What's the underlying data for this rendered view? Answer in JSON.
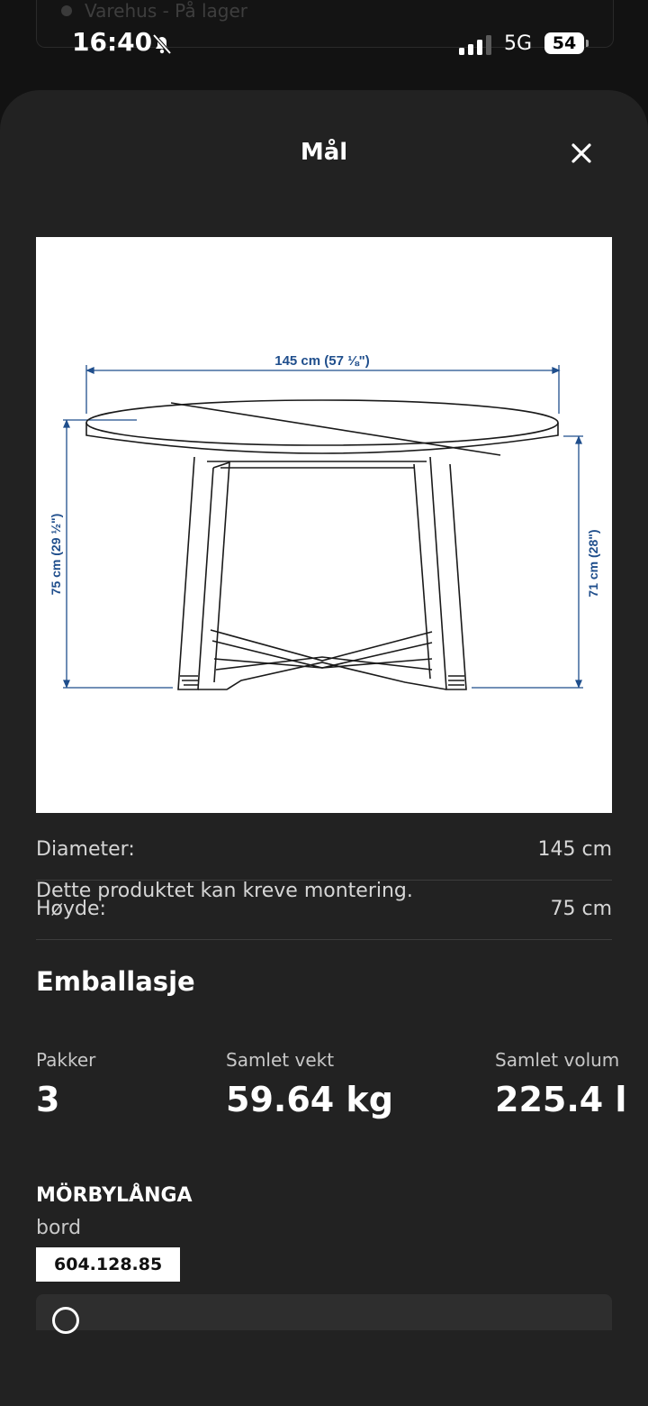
{
  "background_card": {
    "text": "Varehus - På lager"
  },
  "status_bar": {
    "time": "16:40",
    "network": "5G",
    "battery": "54"
  },
  "sheet": {
    "title": "Mål",
    "close_icon": "close-icon"
  },
  "diagram": {
    "width_label": "145 cm (57 ⅛\")",
    "height_label": "75 cm (29 ½\")",
    "leg_height_label": "71 cm (28\")"
  },
  "dimensions": [
    {
      "label": "Diameter:",
      "value": "145 cm"
    },
    {
      "label": "Høyde:",
      "value": "75 cm"
    }
  ],
  "assembly_note": "Dette produktet kan kreve montering.",
  "packaging": {
    "heading": "Emballasje",
    "packages_label": "Pakker",
    "packages_value": "3",
    "weight_label": "Samlet vekt",
    "weight_value": "59.64 kg",
    "volume_label": "Samlet volum",
    "volume_value": "225.4 l"
  },
  "product": {
    "name": "MÖRBYLÅNGA",
    "type": "bord",
    "article_number": "604.128.85"
  },
  "colors": {
    "dimension_blue": "#1f4e8c",
    "sheet_bg": "#222222"
  }
}
